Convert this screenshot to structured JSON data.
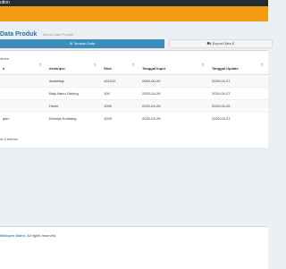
{
  "app": {
    "topbar_title": "ution"
  },
  "header": {
    "title": "Data Produk",
    "subtitle": "Kelola Data Produk"
  },
  "toolbar": {
    "add_label": "⊕ Tambah Data",
    "export_label": "Export Data E"
  },
  "table": {
    "entries_label": "ntries",
    "columns": [
      "k",
      "deskripsi",
      "Stok",
      "Tanggal Input",
      "Tanggal Update"
    ],
    "rows": [
      [
        "",
        "dsdsfdsjs",
        "191312",
        "0000-00-00",
        "2020-04-27"
      ],
      [
        "",
        "Baju Nanu Oblong",
        "100",
        "2020-04-26",
        "2020-04-27"
      ],
      [
        "",
        "Holmi",
        "1000",
        "2020-04-26",
        "2020-04-26"
      ],
      [
        "gan",
        "Kemeja Kotalang",
        "1023",
        "2020-04-26",
        "2020-04-27"
      ]
    ],
    "info_label": "of 4 entries"
  },
  "footer": {
    "brand": "Waisyah Wahri",
    "text": ". All rights reserved."
  },
  "colors": {
    "accent": "#3c8dbc",
    "banner": "#f39c12",
    "topbar": "#222d32"
  }
}
